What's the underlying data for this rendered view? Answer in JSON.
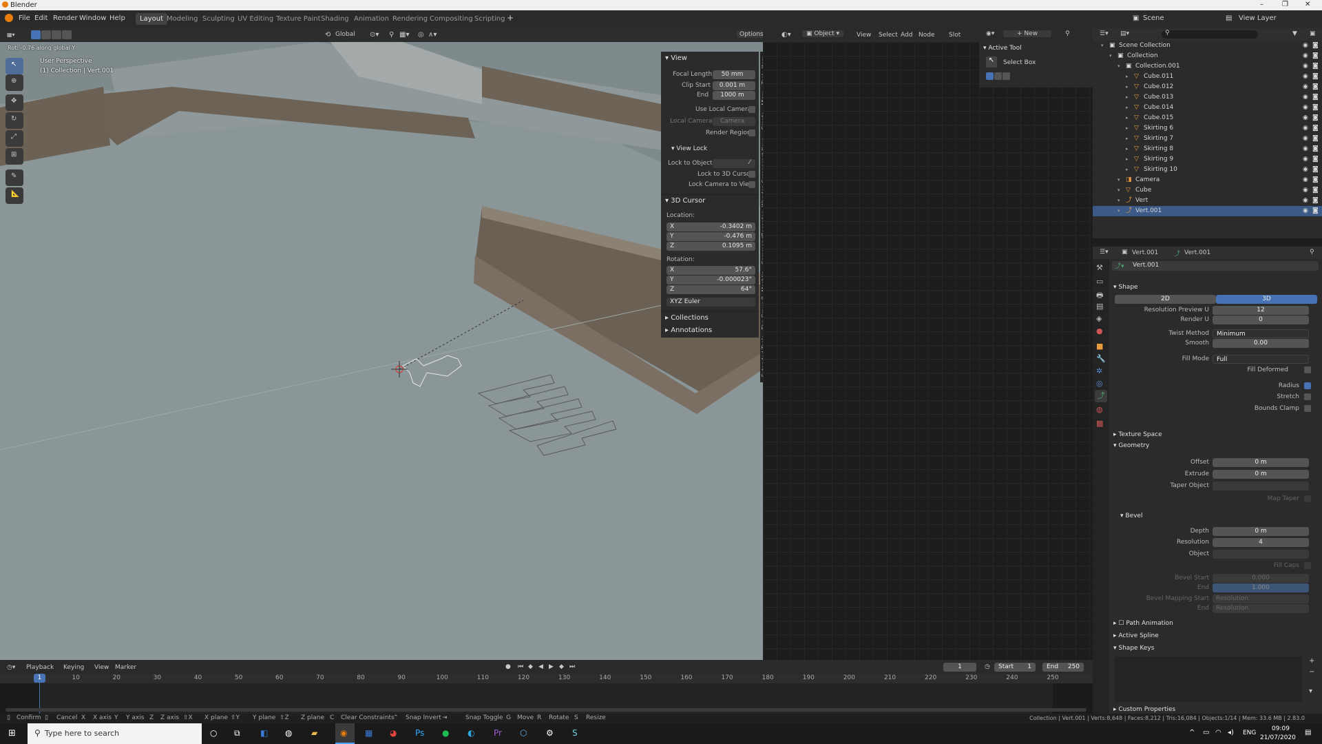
{
  "window": {
    "title": "Blender"
  },
  "menu": [
    "File",
    "Edit",
    "Render",
    "Window",
    "Help"
  ],
  "workspaces": [
    "Layout",
    "Modeling",
    "Sculpting",
    "UV Editing",
    "Texture Paint",
    "Shading",
    "Animation",
    "Rendering",
    "Compositing",
    "Scripting"
  ],
  "active_workspace": "Layout",
  "scene_label": "Scene",
  "view_layer_label": "View Layer",
  "viewport": {
    "header_info": "Rot: -0.76 along global Y",
    "orientation": "Global",
    "options": "Options",
    "overlay_title": "User Perspective",
    "overlay_sub": "(1) Collection | Vert.001"
  },
  "npanel": {
    "view_title": "View",
    "focal_length_label": "Focal Length",
    "focal_length": "50 mm",
    "clip_start_label": "Clip Start",
    "clip_start": "0.001 m",
    "end_label": "End",
    "end": "1000 m",
    "use_local_camera": "Use Local Camera",
    "local_camera_label": "Local Camera",
    "local_camera": "Camera",
    "render_region": "Render Region",
    "view_lock_title": "View Lock",
    "lock_to_object": "Lock to Object",
    "lock_to_cursor": "Lock to 3D Cursor",
    "lock_camera": "Lock Camera to View",
    "cursor_title": "3D Cursor",
    "location_label": "Location:",
    "loc": [
      {
        "axis": "X",
        "v": "-0.3402 m"
      },
      {
        "axis": "Y",
        "v": "-0.476 m"
      },
      {
        "axis": "Z",
        "v": "0.1095 m"
      }
    ],
    "rotation_label": "Rotation:",
    "rot": [
      {
        "axis": "X",
        "v": "57.6°"
      },
      {
        "axis": "Y",
        "v": "-0.000023°"
      },
      {
        "axis": "Z",
        "v": "64°"
      }
    ],
    "euler": "XYZ Euler",
    "collections": "Collections",
    "annotations": "Annotations",
    "tabs": [
      "Item",
      "Tool",
      "View",
      "Create",
      "Screencast Keys",
      "Wander",
      "CommandRecorder",
      "Meshlin",
      "The Grove 8",
      "Extended Tools"
    ]
  },
  "node_header": {
    "mode": "Object",
    "menus": [
      "View",
      "Select",
      "Add",
      "Node"
    ],
    "slot": "Slot",
    "new": "New"
  },
  "active_tool": {
    "title": "Active Tool",
    "tool": "Select Box"
  },
  "outliner": {
    "rows": [
      {
        "label": "Scene Collection",
        "indent": 0
      },
      {
        "label": "Collection",
        "indent": 1
      },
      {
        "label": "Collection.001",
        "indent": 2
      },
      {
        "label": "Cube.011",
        "indent": 3
      },
      {
        "label": "Cube.012",
        "indent": 3
      },
      {
        "label": "Cube.013",
        "indent": 3
      },
      {
        "label": "Cube.014",
        "indent": 3
      },
      {
        "label": "Cube.015",
        "indent": 3
      },
      {
        "label": "Skirting 6",
        "indent": 3
      },
      {
        "label": "Skirting 7",
        "indent": 3
      },
      {
        "label": "Skirting 8",
        "indent": 3
      },
      {
        "label": "Skirting 9",
        "indent": 3
      },
      {
        "label": "Skirting 10",
        "indent": 3
      },
      {
        "label": "Camera",
        "indent": 2
      },
      {
        "label": "Cube",
        "indent": 2
      },
      {
        "label": "Vert",
        "indent": 2
      },
      {
        "label": "Vert.001",
        "indent": 2,
        "selected": true
      }
    ]
  },
  "props": {
    "object_name": "Vert.001",
    "data_name": "Vert.001",
    "datablock": "Vert.001",
    "shape_title": "Shape",
    "dim_2d": "2D",
    "dim_3d": "3D",
    "res_preview_label": "Resolution Preview U",
    "res_preview": "12",
    "render_u_label": "Render U",
    "render_u": "0",
    "twist_label": "Twist Method",
    "twist": "Minimum",
    "smooth_label": "Smooth",
    "smooth": "0.00",
    "fill_label": "Fill Mode",
    "fill": "Full",
    "fill_deformed": "Fill Deformed",
    "radius": "Radius",
    "stretch": "Stretch",
    "bounds_clamp": "Bounds Clamp",
    "texture_space": "Texture Space",
    "geometry": "Geometry",
    "offset_label": "Offset",
    "offset": "0 m",
    "extrude_label": "Extrude",
    "extrude": "0 m",
    "taper_label": "Taper Object",
    "map_taper": "Map Taper",
    "bevel": "Bevel",
    "depth_label": "Depth",
    "depth": "0 m",
    "resolution_label": "Resolution",
    "resolution": "4",
    "object_label": "Object",
    "fill_caps": "Fill Caps",
    "bevel_start_label": "Bevel Start",
    "bevel_start": "0.000",
    "bevel_end_label": "End",
    "bevel_end": "1.000",
    "bevel_map_start_label": "Bevel Mapping Start",
    "bevel_map_start": "Resolution",
    "bevel_map_end_label": "End",
    "bevel_map_end": "Resolution",
    "path_animation": "Path Animation",
    "active_spline": "Active Spline",
    "shape_keys": "Shape Keys",
    "custom_props": "Custom Properties"
  },
  "timeline": {
    "menus": [
      "Playback",
      "Keying",
      "View",
      "Marker"
    ],
    "current_frame": "1",
    "start_label": "Start",
    "start": "1",
    "end_label": "End",
    "end": "250",
    "ticks": [
      "1",
      "10",
      "20",
      "30",
      "40",
      "50",
      "60",
      "70",
      "80",
      "90",
      "100",
      "110",
      "120",
      "130",
      "140",
      "150",
      "160",
      "170",
      "180",
      "190",
      "200",
      "210",
      "220",
      "230",
      "240",
      "250"
    ]
  },
  "status": {
    "keys": [
      "Confirm",
      "Cancel",
      "X axis",
      "Y axis",
      "Z axis",
      "X plane",
      "Y plane",
      "Z plane",
      "Clear Constraints",
      "Snap Invert",
      "Snap Toggle",
      "Move",
      "Rotate",
      "Resize"
    ],
    "info": "Collection | Vert.001 | Verts:8,648 | Faces:8,212 | Tris:16,084 | Objects:1/14 | Mem: 33.6 MB | 2.83.0"
  },
  "taskbar": {
    "search_placeholder": "Type here to search",
    "lang": "ENG",
    "time": "09:09",
    "date": "21/07/2020"
  },
  "colors": {
    "accent": "#4772b3",
    "selected_row": "#3c5a87",
    "viewport_bg": "#8a9597"
  }
}
